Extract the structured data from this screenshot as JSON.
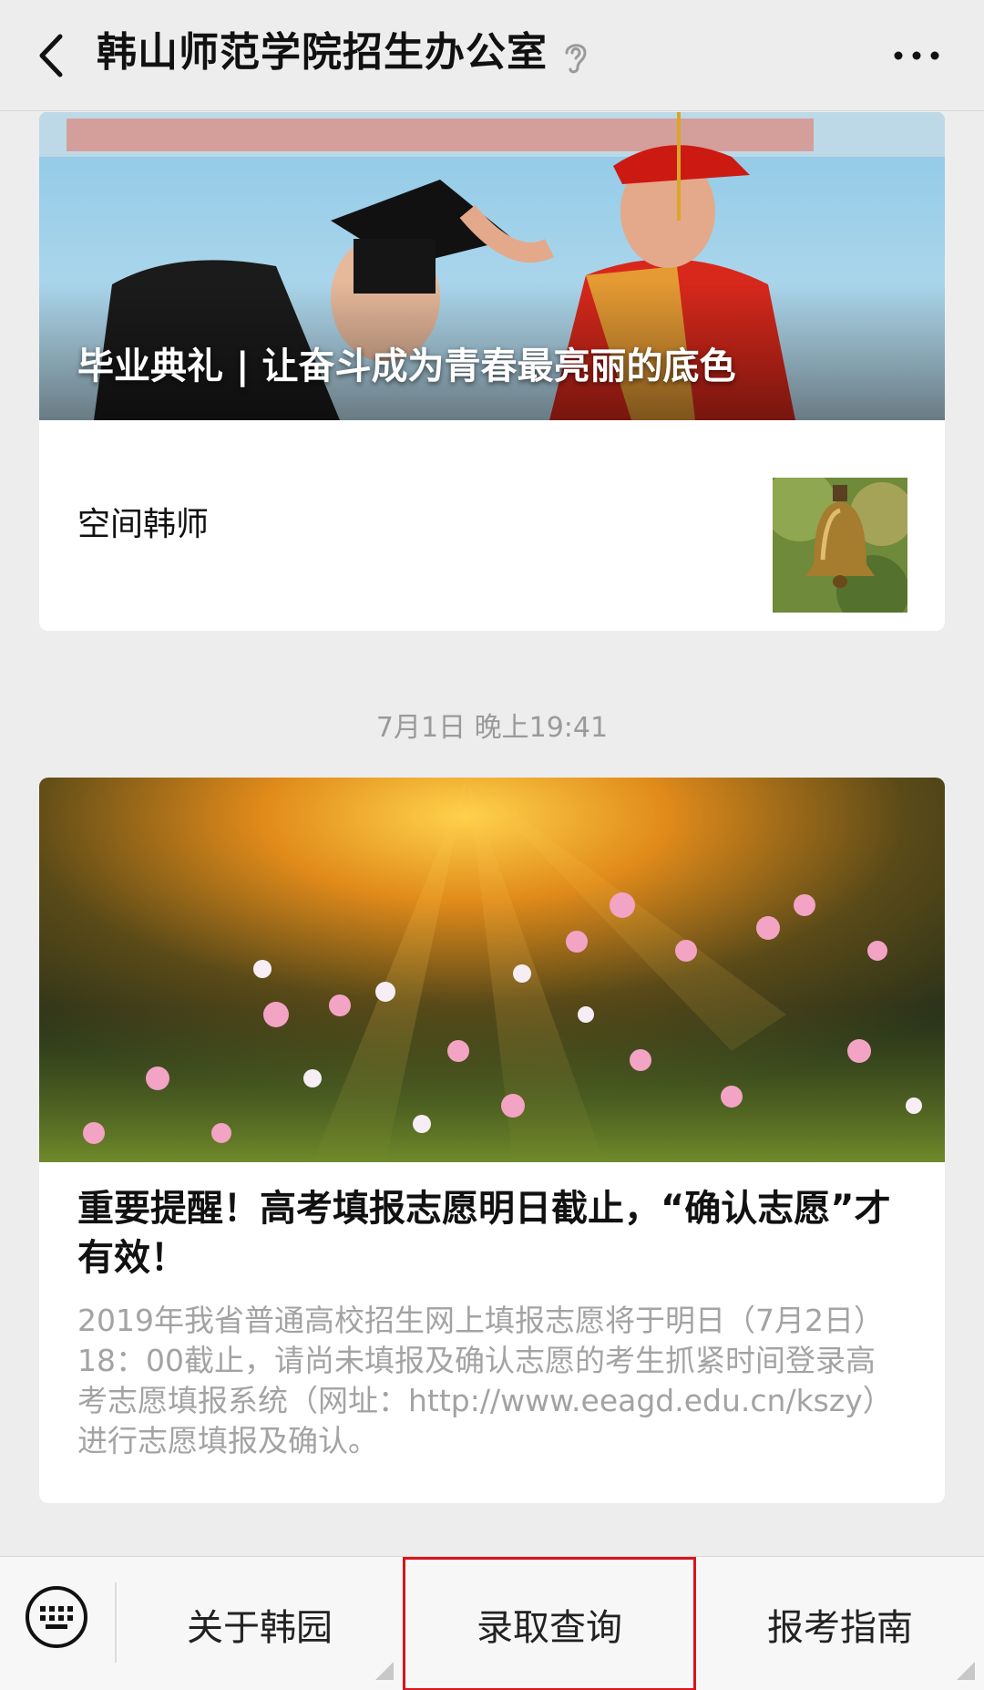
{
  "header": {
    "title": "韩山师范学院招生办公室",
    "back_icon": "chevron-left-icon",
    "ear_icon": "ear-icon",
    "more_icon": "more-dots-icon"
  },
  "feed": {
    "card1": {
      "cover_title": "毕业典礼 | 让奋斗成为青春最亮丽的底色",
      "sub_item_title": "空间韩师"
    },
    "timestamp": "7月1日 晚上19:41",
    "card2": {
      "title": "重要提醒！高考填报志愿明日截止，“确认志愿”才有效！",
      "summary": "2019年我省普通高校招生网上填报志愿将于明日（7月2日）18：00截止，请尚未填报及确认志愿的考生抓紧时间登录高考志愿填报系统（网址：http://www.eeagd.edu.cn/kszy）进行志愿填报及确认。"
    }
  },
  "bottom_menu": {
    "keyboard_icon": "keyboard-icon",
    "items": [
      {
        "label": "关于韩园"
      },
      {
        "label": "录取查询"
      },
      {
        "label": "报考指南"
      }
    ],
    "highlight_color": "#d9141c"
  }
}
